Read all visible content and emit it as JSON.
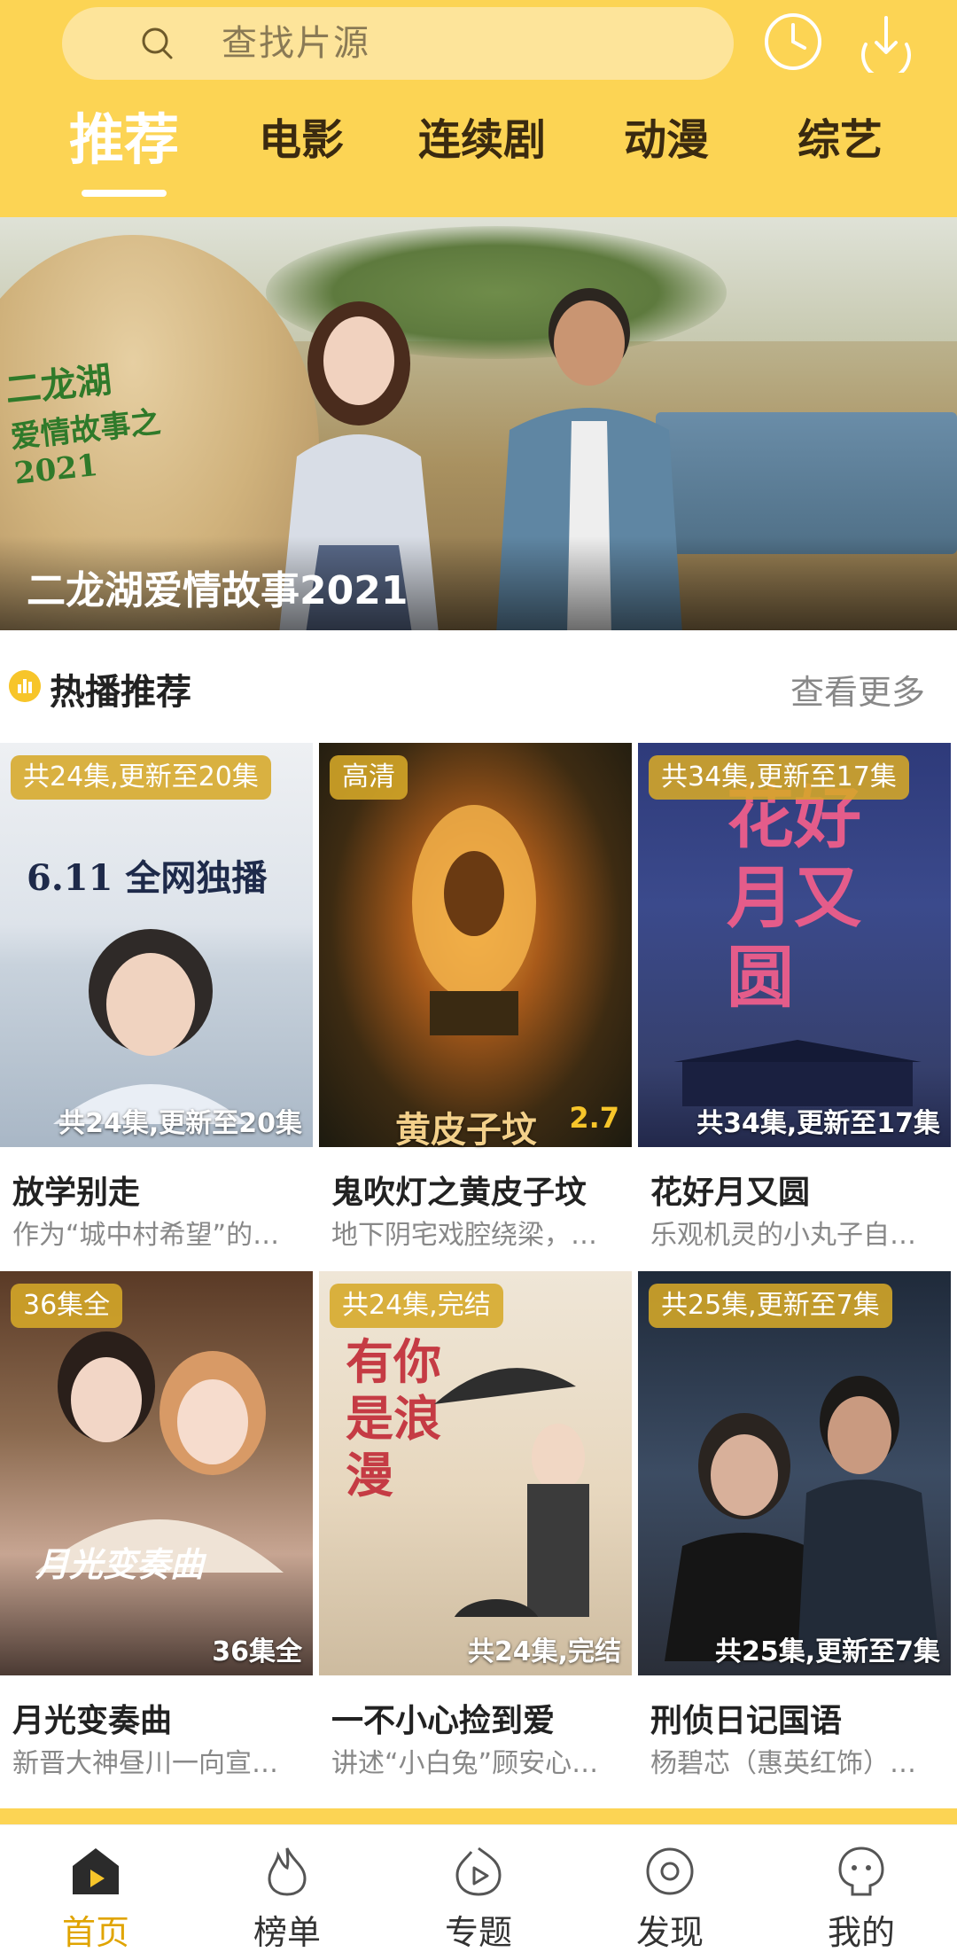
{
  "search": {
    "placeholder": "查找片源"
  },
  "tabs": [
    {
      "label": "推荐"
    },
    {
      "label": "电影"
    },
    {
      "label": "连续剧"
    },
    {
      "label": "动漫"
    },
    {
      "label": "综艺"
    }
  ],
  "banner": {
    "logo_line1": "二龙湖",
    "logo_line2": "爱情故事之2021",
    "caption": "二龙湖爱情故事2021"
  },
  "section": {
    "title": "热播推荐",
    "more": "查看更多"
  },
  "cards": [
    {
      "badge": "共24集,更新至20集",
      "bottom": "共24集,更新至20集",
      "title": "放学别走",
      "desc": "作为“城中村希望”的…",
      "art_text": "6.11 全网独播"
    },
    {
      "badge": "高清",
      "bottom": "黄皮子坟",
      "score": "2.7",
      "title": "鬼吹灯之黄皮子坟",
      "desc": "地下阴宅戏腔绕梁，…"
    },
    {
      "badge": "共34集,更新至17集",
      "bottom": "共34集,更新至17集",
      "title": "花好月又圆",
      "desc": "乐观机灵的小丸子自…",
      "art_text": "花好月又圆"
    },
    {
      "badge": "36集全",
      "bottom": "36集全",
      "title": "月光变奏曲",
      "desc": "新晋大神昼川一向宣…",
      "art_text": "月光变奏曲"
    },
    {
      "badge": "共24集,完结",
      "bottom": "共24集,完结",
      "title": "一不小心捡到爱",
      "desc": "讲述“小白兔”顾安心…",
      "art_text": "有你是浪漫"
    },
    {
      "badge": "共25集,更新至7集",
      "bottom": "共25集,更新至7集",
      "title": "刑侦日记国语",
      "desc": "杨碧芯（惠英红饰）…"
    }
  ],
  "nav": [
    {
      "label": "首页",
      "icon": "home-play-icon"
    },
    {
      "label": "榜单",
      "icon": "flame-icon"
    },
    {
      "label": "专题",
      "icon": "topic-play-icon"
    },
    {
      "label": "发现",
      "icon": "discover-icon"
    },
    {
      "label": "我的",
      "icon": "profile-icon"
    }
  ],
  "colors": {
    "brand": "#fcd454",
    "accent": "#e0a400"
  }
}
